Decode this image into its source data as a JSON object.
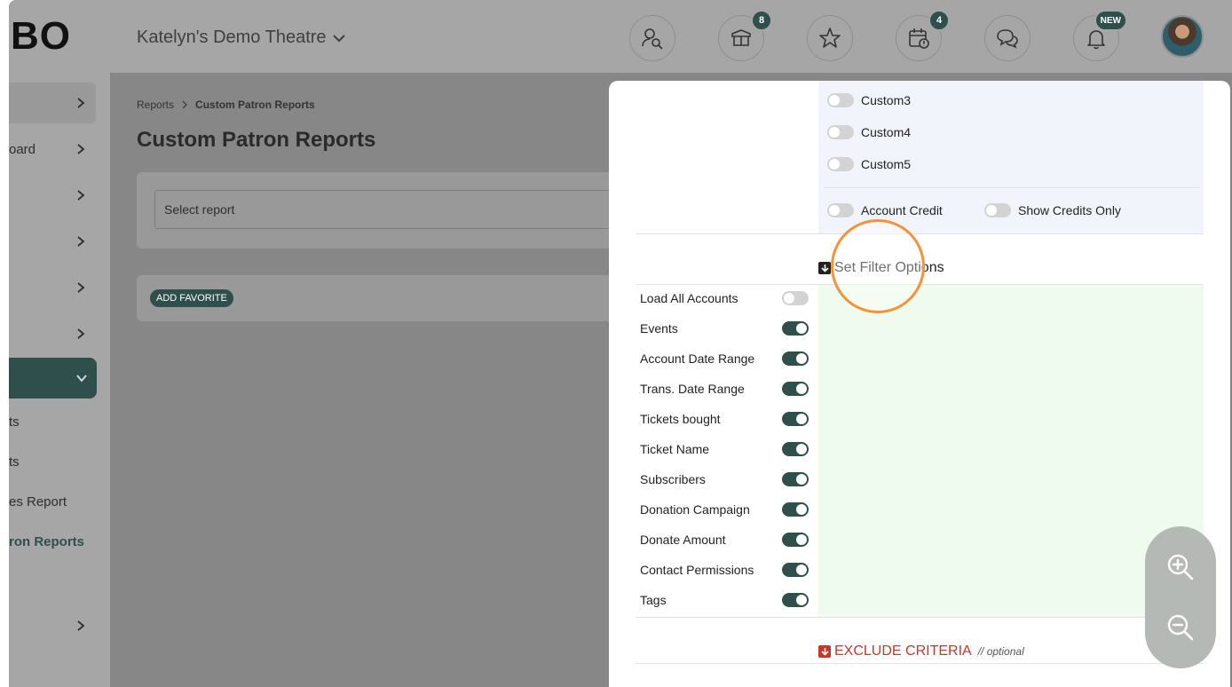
{
  "header": {
    "logo_text": "BO",
    "venue_name": "Katelyn's Demo Theatre",
    "icons": [
      {
        "name": "patron-search-icon",
        "badge": ""
      },
      {
        "name": "box-icon",
        "badge": "8"
      },
      {
        "name": "star-icon",
        "badge": ""
      },
      {
        "name": "calendar-alert-icon",
        "badge": "4"
      },
      {
        "name": "chat-icon",
        "badge": ""
      },
      {
        "name": "bell-icon",
        "badge": "NEW"
      }
    ]
  },
  "sidebar": {
    "items": [
      {
        "label": ""
      },
      {
        "label": "oard"
      },
      {
        "label": ""
      },
      {
        "label": ""
      },
      {
        "label": ""
      },
      {
        "label": ""
      },
      {
        "label": ""
      }
    ],
    "sub_items": [
      {
        "label": "ts"
      },
      {
        "label": "ts"
      },
      {
        "label": "es Report"
      },
      {
        "label": "ron Reports"
      }
    ],
    "bottom_item": {
      "label": ""
    }
  },
  "main": {
    "breadcrumb": {
      "parent": "Reports",
      "current": "Custom Patron Reports"
    },
    "title": "Custom Patron Reports",
    "select_placeholder": "Select report",
    "add_favorite": "ADD FAVORITE"
  },
  "panel": {
    "customs": [
      "Custom3",
      "Custom4",
      "Custom5"
    ],
    "account_credit": "Account Credit",
    "show_credits_only": "Show Credits Only",
    "filter_heading": "Set Filter Options",
    "filters": [
      {
        "label": "Load All Accounts",
        "on": false
      },
      {
        "label": "Events",
        "on": true
      },
      {
        "label": "Account Date Range",
        "on": true
      },
      {
        "label": "Trans. Date Range",
        "on": true
      },
      {
        "label": "Tickets bought",
        "on": true
      },
      {
        "label": "Ticket Name",
        "on": true
      },
      {
        "label": "Subscribers",
        "on": true
      },
      {
        "label": "Donation Campaign",
        "on": true
      },
      {
        "label": "Donate Amount",
        "on": true
      },
      {
        "label": "Contact Permissions",
        "on": true
      },
      {
        "label": "Tags",
        "on": true
      }
    ],
    "exclude_label": "EXCLUDE CRITERIA",
    "exclude_optional": "// optional"
  },
  "colors": {
    "accent": "#2e4f4c",
    "exclude": "#c0392b",
    "highlight": "#f4933a"
  }
}
